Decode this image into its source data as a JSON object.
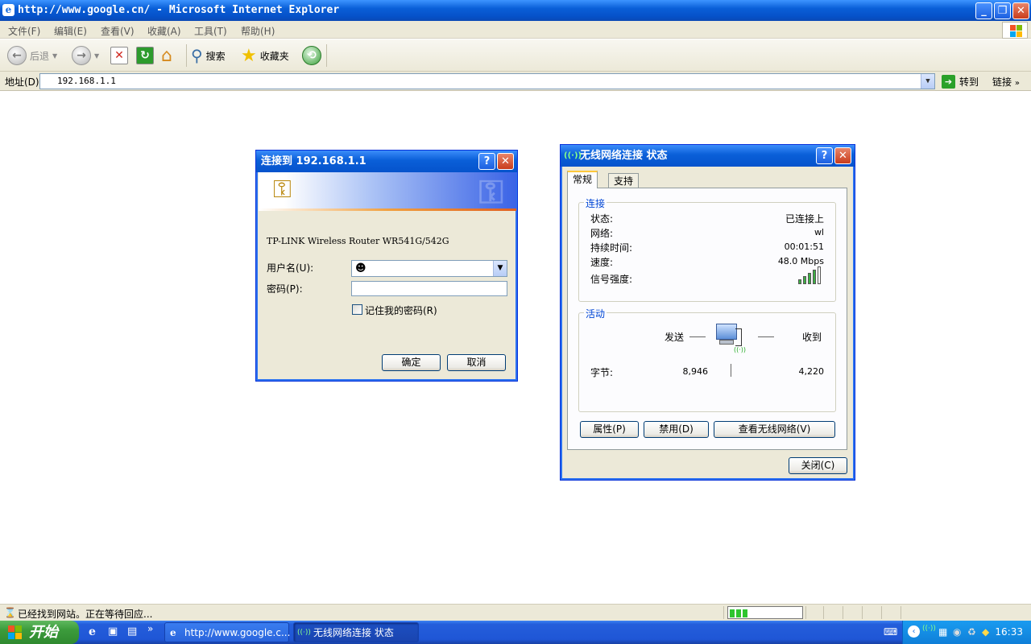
{
  "browser": {
    "title": "http://www.google.cn/ - Microsoft Internet Explorer",
    "menus": [
      "文件(F)",
      "编辑(E)",
      "查看(V)",
      "收藏(A)",
      "工具(T)",
      "帮助(H)"
    ],
    "toolbar": {
      "back": "后退",
      "search": "搜索",
      "favorites": "收藏夹"
    },
    "address": {
      "label": "地址(D)",
      "value": "192.168.1.1",
      "go": "转到",
      "links": "链接"
    },
    "status": "已经找到网站。正在等待回应..."
  },
  "login_dialog": {
    "title": "连接到 192.168.1.1",
    "realm": "TP-LINK Wireless Router WR541G/542G",
    "username_label": "用户名(U):",
    "password_label": "密码(P):",
    "remember": "记住我的密码(R)",
    "ok": "确定",
    "cancel": "取消"
  },
  "wifi_dialog": {
    "title": "无线网络连接 状态",
    "tabs": [
      "常规",
      "支持"
    ],
    "connection": {
      "title": "连接",
      "rows": [
        {
          "label": "状态:",
          "value": "已连接上"
        },
        {
          "label": "网络:",
          "value": "wl"
        },
        {
          "label": "持续时间:",
          "value": "00:01:51"
        },
        {
          "label": "速度:",
          "value": "48.0 Mbps"
        }
      ],
      "signal_label": "信号强度:",
      "signal_bars": 4,
      "signal_max": 5
    },
    "activity": {
      "title": "活动",
      "sent_label": "发送",
      "received_label": "收到",
      "bytes_label": "字节:",
      "bytes_sent": "8,946",
      "bytes_received": "4,220"
    },
    "buttons": {
      "properties": "属性(P)",
      "disable": "禁用(D)",
      "view_networks": "查看无线网络(V)",
      "close": "关闭(C)"
    }
  },
  "taskbar": {
    "start": "开始",
    "tasks": [
      "http://www.google.c...",
      "无线网络连接 状态"
    ],
    "clock": "16:33"
  },
  "progress": 0.3,
  "colors": {
    "title_blue": "#0a5fd8",
    "start_green": "#3c9b3c",
    "progress_green": "#2ec52e"
  }
}
